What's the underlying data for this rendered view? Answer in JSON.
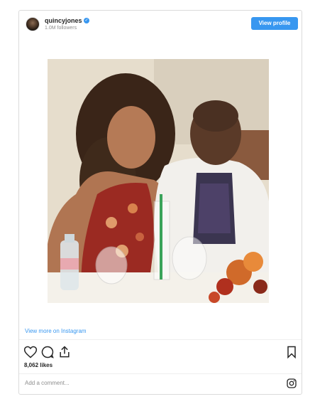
{
  "header": {
    "username": "quincyjones",
    "verified_glyph": "✓",
    "followers": "1.0M followers",
    "view_profile_label": "View profile"
  },
  "photo": {
    "alt": "photo of two people seated at a restaurant table"
  },
  "footer": {
    "view_more_label": "View more on Instagram",
    "likes": "8,062 likes",
    "comment_placeholder": "Add a comment..."
  },
  "icons": [
    "heart-icon",
    "comment-icon",
    "share-icon",
    "bookmark-icon",
    "instagram-icon"
  ],
  "colors": {
    "accent": "#3897f0",
    "text": "#262626",
    "muted": "#8e8e8e",
    "border": "#dbdbdb"
  }
}
